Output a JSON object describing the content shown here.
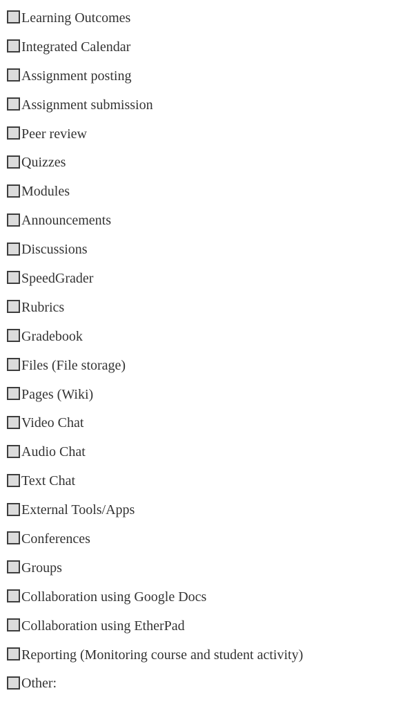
{
  "checklist": {
    "items": [
      {
        "label": "Learning Outcomes",
        "checked": false
      },
      {
        "label": "Integrated Calendar",
        "checked": false
      },
      {
        "label": "Assignment posting",
        "checked": false
      },
      {
        "label": "Assignment submission",
        "checked": false
      },
      {
        "label": "Peer review",
        "checked": false
      },
      {
        "label": "Quizzes",
        "checked": false
      },
      {
        "label": "Modules",
        "checked": false
      },
      {
        "label": "Announcements",
        "checked": false
      },
      {
        "label": "Discussions",
        "checked": false
      },
      {
        "label": "SpeedGrader",
        "checked": false
      },
      {
        "label": "Rubrics",
        "checked": false
      },
      {
        "label": "Gradebook",
        "checked": false
      },
      {
        "label": "Files (File storage)",
        "checked": false
      },
      {
        "label": "Pages (Wiki)",
        "checked": false
      },
      {
        "label": "Video Chat",
        "checked": false
      },
      {
        "label": "Audio Chat",
        "checked": false
      },
      {
        "label": "Text Chat",
        "checked": false
      },
      {
        "label": "External Tools/Apps",
        "checked": false
      },
      {
        "label": "Conferences",
        "checked": false
      },
      {
        "label": "Groups",
        "checked": false
      },
      {
        "label": "Collaboration using Google Docs",
        "checked": false
      },
      {
        "label": "Collaboration using EtherPad",
        "checked": false
      },
      {
        "label": "Reporting (Monitoring course and student activity)",
        "checked": false
      },
      {
        "label": "Other:",
        "checked": false
      }
    ]
  },
  "colors": {
    "text": "#333333",
    "checkbox_border": "#3d3d3d",
    "checkbox_fill": "#dcdcdc",
    "background": "#ffffff"
  }
}
